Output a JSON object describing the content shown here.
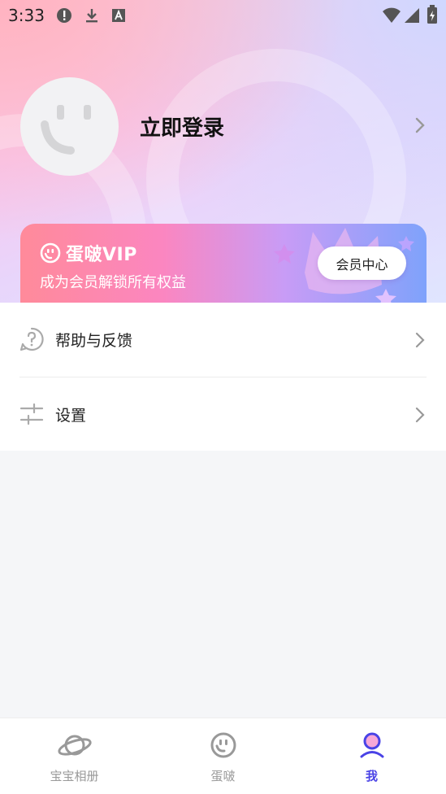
{
  "status_bar": {
    "time": "3:33",
    "icons": [
      "alert-icon",
      "download-icon",
      "font-icon",
      "wifi-icon",
      "signal-icon",
      "battery-icon"
    ]
  },
  "profile": {
    "login_label": "立即登录",
    "avatar_icon": "smiley-avatar-icon"
  },
  "vip": {
    "brand": "蛋啵VIP",
    "subtitle": "成为会员解锁所有权益",
    "member_button": "会员中心"
  },
  "menu": {
    "items": [
      {
        "label": "帮助与反馈",
        "icon": "help-icon"
      },
      {
        "label": "设置",
        "icon": "settings-sliders-icon"
      }
    ]
  },
  "bottom_nav": {
    "items": [
      {
        "label": "宝宝相册",
        "icon": "planet-icon",
        "active": false
      },
      {
        "label": "蛋啵",
        "icon": "smiley-icon",
        "active": false
      },
      {
        "label": "我",
        "icon": "profile-icon",
        "active": true
      }
    ]
  },
  "colors": {
    "accent": "#4a43e6",
    "text_primary": "#222222",
    "inactive": "#999999"
  }
}
